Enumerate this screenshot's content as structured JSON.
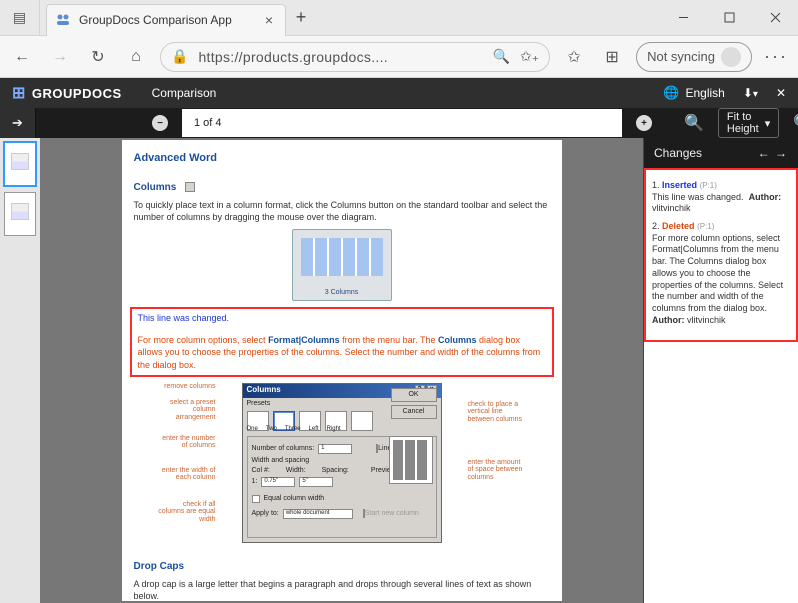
{
  "browser": {
    "tab_title": "GroupDocs Comparison App",
    "url": "https://products.groupdocs....",
    "sync_label": "Not syncing"
  },
  "app": {
    "brand": "GROUPDOCS",
    "section": "Comparison",
    "language": "English"
  },
  "toolbar": {
    "page_label": "1 of 4",
    "fit_label": "Fit to Height"
  },
  "doc": {
    "h_advanced": "Advanced Word",
    "h_columns": "Columns",
    "p_columns": "To quickly place text in a column format, click the Columns button on the standard toolbar and select the number of columns by dragging the mouse over the diagram.",
    "col_caption": "3 Columns",
    "inserted": "This line was changed.",
    "deleted_pre": "For more column options, select ",
    "deleted_b1": "Format|Columns",
    "deleted_mid": " from the menu bar. The ",
    "deleted_b2": "Columns",
    "deleted_post": " dialog box allows you to choose the properties of the columns. Select the number and width of the columns from the dialog box.",
    "h_dropcaps": "Drop Caps",
    "p_dropcaps": "A drop cap is a large letter that begins a paragraph and drops through several lines of text as shown below.",
    "ann": {
      "remove": "remove columns",
      "select": "select a preset column arrangement",
      "number": "enter the number of columns",
      "width": "enter the width of each column",
      "equal": "check if all columns are equal width",
      "vline": "check to place a vertical line between columns",
      "space": "enter the amount of space between columns"
    },
    "dialog": {
      "title": "Columns",
      "presets": [
        "One",
        "Two",
        "Three",
        "Left",
        "Right"
      ],
      "ok": "OK",
      "cancel": "Cancel",
      "lbl_presets": "Presets",
      "lbl_number": "Number of columns:",
      "num_value": "1",
      "chk_line": "Line between",
      "grp_width": "Width and spacing",
      "col_hdr": "Col #:",
      "width_hdr": "Width:",
      "spacing_hdr": "Spacing:",
      "col_val": "1:",
      "width_val": "0.75\"",
      "spacing_val": "5\"",
      "chk_equal": "Equal column width",
      "apply_to": "Apply to:",
      "apply_val": "whole document",
      "chk_newcol": "Start new column",
      "preview": "Preview"
    }
  },
  "changes": {
    "title": "Changes",
    "items": [
      {
        "num": "1.",
        "type": "Inserted",
        "page": "(P:1)",
        "text": "This line was changed.",
        "author_lbl": "Author:",
        "author": "vlitvinchik"
      },
      {
        "num": "2.",
        "type": "Deleted",
        "page": "(P:1)",
        "text": "For more column options, select Format|Columns from the menu bar. The Columns dialog box allows you to choose the properties of the columns. Select the number and width of the columns from the dialog box.",
        "author_lbl": "Author:",
        "author": "vlitvinchik"
      }
    ]
  }
}
